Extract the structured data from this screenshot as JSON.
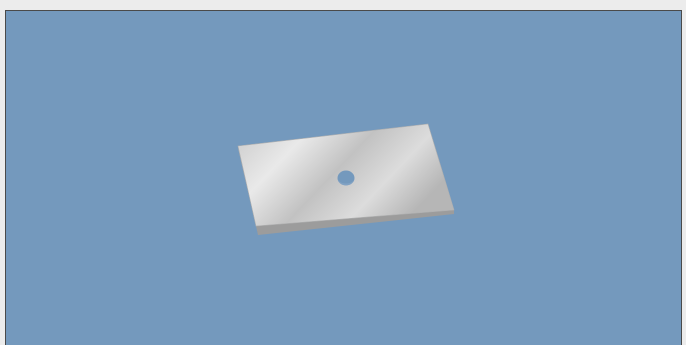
{
  "viewport": {
    "background_color": "#7499bd",
    "border_color": "#4a4a4a"
  },
  "model": {
    "name": "plate-with-hole",
    "top_face_colors": [
      "#e8e8e8",
      "#bdbdbd",
      "#dedede",
      "#b9b9b9"
    ],
    "edge_color": "#9c9c9c",
    "hole_color": "#7499bd"
  }
}
